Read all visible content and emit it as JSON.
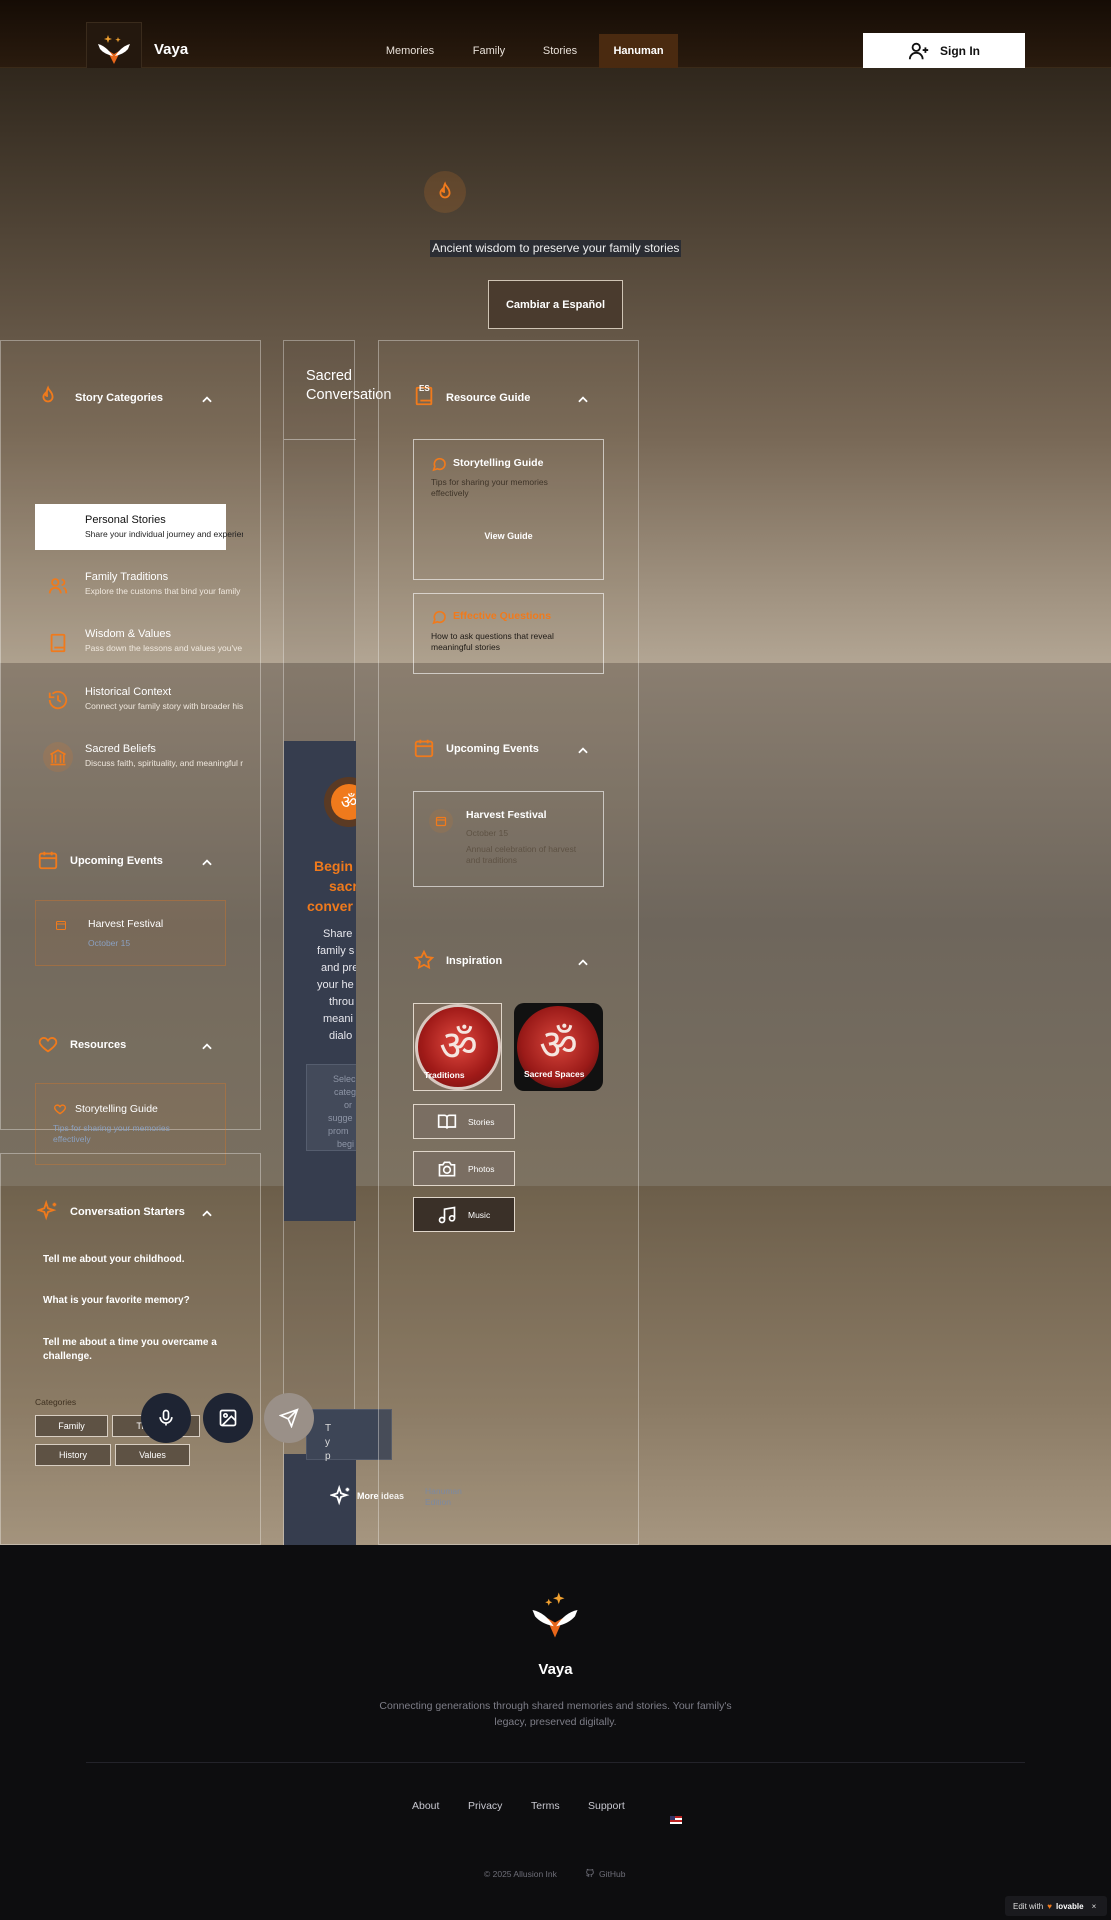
{
  "colors": {
    "accent": "#f07a1c",
    "header_bg": "#1e140a",
    "footer_bg": "#0d0d0f",
    "active_nav": "#4a2a10"
  },
  "header": {
    "brand": "Vaya",
    "nav": [
      "Memories",
      "Family",
      "Stories",
      "Hanuman"
    ],
    "active_nav": "Hanuman",
    "sign_in": "Sign In"
  },
  "hero": {
    "tagline": "Ancient wisdom to preserve your family stories",
    "language_button": "Cambiar a Español"
  },
  "left_panel": {
    "story_categories": {
      "title": "Story Categories",
      "items": [
        {
          "title": "Personal Stories",
          "desc": "Share your individual journey and experiences",
          "icon": "user-icon"
        },
        {
          "title": "Family Traditions",
          "desc": "Explore the customs that bind your family",
          "icon": "users-icon"
        },
        {
          "title": "Wisdom & Values",
          "desc": "Pass down the lessons and values you've learned",
          "icon": "book-icon"
        },
        {
          "title": "Historical Context",
          "desc": "Connect your family story with broader history",
          "icon": "history-icon"
        },
        {
          "title": "Sacred Beliefs",
          "desc": "Discuss faith, spirituality, and meaningful rituals",
          "icon": "temple-icon"
        }
      ]
    },
    "upcoming_events": {
      "title": "Upcoming Events",
      "event_title": "Harvest Festival",
      "event_date": "October 15"
    },
    "resources": {
      "title": "Resources",
      "item_title": "Storytelling Guide",
      "item_desc": "Tips for sharing your memories effectively"
    }
  },
  "starters_panel": {
    "title": "Conversation Starters",
    "prompts": [
      "Tell me about your childhood.",
      "What is your favorite memory?",
      "Tell me about a time you overcame a challenge."
    ],
    "categories_label": "Categories",
    "chips": [
      "Family",
      "Traditions",
      "History",
      "Values"
    ]
  },
  "center": {
    "title_line1": "Sacred",
    "title_line2": "Conversation",
    "begin_lines": [
      "Begin",
      "sacr",
      "conver"
    ],
    "body_lines": [
      "Share",
      "family s",
      "and pre",
      "your he",
      "throu",
      "meani",
      "dialo"
    ],
    "hint_lines": [
      "Selec",
      "categ",
      "or",
      "sugge",
      "prom",
      "begi"
    ],
    "input_lines": [
      "T",
      "y",
      "p"
    ],
    "more_ideas": "More ideas",
    "edition_line1": "Hanuman",
    "edition_line2": "Edition"
  },
  "right_panel": {
    "resource_guide": {
      "title": "Resource Guide",
      "card1_title": "Storytelling Guide",
      "card1_desc": "Tips for sharing your memories effectively",
      "card1_action": "View Guide",
      "card2_title": "Effective Questions",
      "card2_desc": "How to ask questions that reveal meaningful stories"
    },
    "upcoming_events": {
      "title": "Upcoming Events",
      "event_title": "Harvest Festival",
      "event_date": "October 15",
      "event_desc": "Annual celebration of harvest and traditions"
    },
    "inspiration": {
      "title": "Inspiration",
      "tile1": "Traditions",
      "tile2": "Sacred Spaces",
      "buttons": [
        "Stories",
        "Photos",
        "Music"
      ]
    }
  },
  "footer": {
    "brand": "Vaya",
    "tagline_line1": "Connecting generations through shared memories and stories. Your family's",
    "tagline_line2": "legacy, preserved digitally.",
    "links": [
      "About",
      "Privacy",
      "Terms",
      "Support"
    ],
    "copyright": "© 2025 Allusion Ink",
    "github": "GitHub",
    "edit_with": "Edit with",
    "lovable": "lovable"
  }
}
